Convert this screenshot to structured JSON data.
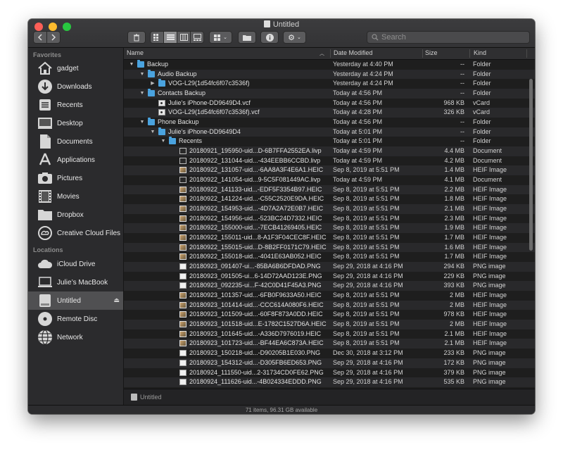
{
  "window": {
    "title": "Untitled"
  },
  "toolbar": {
    "back_icon": "chevron-left-icon",
    "forward_icon": "chevron-right-icon",
    "trash_icon": "trash-icon",
    "view_modes": [
      "icon-view",
      "list-view",
      "column-view",
      "gallery-view"
    ],
    "active_view": "list-view",
    "group_icon": "group-by-icon",
    "newfolder_icon": "new-folder-icon",
    "info_icon": "info-icon",
    "action_icon": "gear-icon",
    "search_placeholder": "Search"
  },
  "sidebar": {
    "favorites_header": "Favorites",
    "favorites": [
      {
        "label": "gadget",
        "icon": "home-icon"
      },
      {
        "label": "Downloads",
        "icon": "download-icon"
      },
      {
        "label": "Recents",
        "icon": "recents-icon"
      },
      {
        "label": "Desktop",
        "icon": "desktop-icon"
      },
      {
        "label": "Documents",
        "icon": "documents-icon"
      },
      {
        "label": "Applications",
        "icon": "applications-icon"
      },
      {
        "label": "Pictures",
        "icon": "pictures-icon"
      },
      {
        "label": "Movies",
        "icon": "movies-icon"
      },
      {
        "label": "Dropbox",
        "icon": "folder-icon"
      },
      {
        "label": "Creative Cloud Files",
        "icon": "creative-cloud-icon"
      }
    ],
    "locations_header": "Locations",
    "locations": [
      {
        "label": "iCloud Drive",
        "icon": "cloud-icon"
      },
      {
        "label": "Julie’s MacBook",
        "icon": "laptop-icon"
      },
      {
        "label": "Untitled",
        "icon": "drive-icon",
        "selected": true
      },
      {
        "label": "Remote Disc",
        "icon": "disc-icon"
      },
      {
        "label": "Network",
        "icon": "network-icon"
      }
    ],
    "eject_icon": "eject-icon"
  },
  "columns": {
    "name": "Name",
    "date": "Date Modified",
    "size": "Size",
    "kind": "Kind"
  },
  "files": [
    {
      "name": "Backup",
      "date": "Yesterday at 4:40 PM",
      "size": "--",
      "kind": "Folder",
      "level": 0,
      "disclosure": "open",
      "icon": "folder"
    },
    {
      "name": "Audio Backup",
      "date": "Yesterday at 4:24 PM",
      "size": "--",
      "kind": "Folder",
      "level": 1,
      "disclosure": "open",
      "icon": "folder"
    },
    {
      "name": "VOG-L29(1d54fc6f07c3536f)",
      "date": "Yesterday at 4:24 PM",
      "size": "--",
      "kind": "Folder",
      "level": 2,
      "disclosure": "closed",
      "icon": "folder"
    },
    {
      "name": "Contacts Backup",
      "date": "Today at 4:56 PM",
      "size": "--",
      "kind": "Folder",
      "level": 1,
      "disclosure": "open",
      "icon": "folder"
    },
    {
      "name": "Julie’s iPhone-DD9649D4.vcf",
      "date": "Today at 4:56 PM",
      "size": "968 KB",
      "kind": "vCard",
      "level": 2,
      "disclosure": "none",
      "icon": "vcard"
    },
    {
      "name": "VOG-L29(1d54fc6f07c3536f).vcf",
      "date": "Today at 4:28 PM",
      "size": "326 KB",
      "kind": "vCard",
      "level": 2,
      "disclosure": "none",
      "icon": "vcard"
    },
    {
      "name": "Phone Backup",
      "date": "Today at 4:56 PM",
      "size": "--",
      "kind": "Folder",
      "level": 1,
      "disclosure": "open",
      "icon": "folder"
    },
    {
      "name": "Julie’s iPhone-DD9649D4",
      "date": "Today at 5:01 PM",
      "size": "--",
      "kind": "Folder",
      "level": 2,
      "disclosure": "open",
      "icon": "folder"
    },
    {
      "name": "Recents",
      "date": "Today at 5:01 PM",
      "size": "--",
      "kind": "Folder",
      "level": 3,
      "disclosure": "open",
      "icon": "folder"
    },
    {
      "name": "20180921_195950-uid...D-6B7FFA2552EA.livp",
      "date": "Today at 4:59 PM",
      "size": "4.4 MB",
      "kind": "Document",
      "level": 4,
      "disclosure": "none",
      "icon": "doc"
    },
    {
      "name": "20180922_131044-uid...-434EEBB6CCBD.livp",
      "date": "Today at 4:59 PM",
      "size": "4.2 MB",
      "kind": "Document",
      "level": 4,
      "disclosure": "none",
      "icon": "doc"
    },
    {
      "name": "20180922_131057-uid...-6AA8A3F4E6A1.HEIC",
      "date": "Sep 8, 2019 at 5:51 PM",
      "size": "1.4 MB",
      "kind": "HEIF Image",
      "level": 4,
      "disclosure": "none",
      "icon": "img"
    },
    {
      "name": "20180922_141054-uid...9-5C5F081449AC.livp",
      "date": "Today at 4:59 PM",
      "size": "4.1 MB",
      "kind": "Document",
      "level": 4,
      "disclosure": "none",
      "icon": "doc"
    },
    {
      "name": "20180922_141133-uid...-EDF5F3354B97.HEIC",
      "date": "Sep 8, 2019 at 5:51 PM",
      "size": "2.2 MB",
      "kind": "HEIF Image",
      "level": 4,
      "disclosure": "none",
      "icon": "img"
    },
    {
      "name": "20180922_141224-uid...-C55C2520E9DA.HEIC",
      "date": "Sep 8, 2019 at 5:51 PM",
      "size": "1.8 MB",
      "kind": "HEIF Image",
      "level": 4,
      "disclosure": "none",
      "icon": "img"
    },
    {
      "name": "20180922_154953-uid...-4D7A2A72E0B7.HEIC",
      "date": "Sep 8, 2019 at 5:51 PM",
      "size": "2.1 MB",
      "kind": "HEIF Image",
      "level": 4,
      "disclosure": "none",
      "icon": "img"
    },
    {
      "name": "20180922_154956-uid...-523BC24D7332.HEIC",
      "date": "Sep 8, 2019 at 5:51 PM",
      "size": "2.3 MB",
      "kind": "HEIF Image",
      "level": 4,
      "disclosure": "none",
      "icon": "img"
    },
    {
      "name": "20180922_155000-uid...-7ECB41269405.HEIC",
      "date": "Sep 8, 2019 at 5:51 PM",
      "size": "1.9 MB",
      "kind": "HEIF Image",
      "level": 4,
      "disclosure": "none",
      "icon": "img"
    },
    {
      "name": "20180922_155011-uid...8-A1F3F04CEC8F.HEIC",
      "date": "Sep 8, 2019 at 5:51 PM",
      "size": "1.7 MB",
      "kind": "HEIF Image",
      "level": 4,
      "disclosure": "none",
      "icon": "img"
    },
    {
      "name": "20180922_155015-uid...D-8B2FF0171C79.HEIC",
      "date": "Sep 8, 2019 at 5:51 PM",
      "size": "1.6 MB",
      "kind": "HEIF Image",
      "level": 4,
      "disclosure": "none",
      "icon": "img"
    },
    {
      "name": "20180922_155018-uid...-4041E63AB052.HEIC",
      "date": "Sep 8, 2019 at 5:51 PM",
      "size": "1.7 MB",
      "kind": "HEIF Image",
      "level": 4,
      "disclosure": "none",
      "icon": "img"
    },
    {
      "name": "20180923_091407-ui...-85BA6B6DFDAD.PNG",
      "date": "Sep 29, 2018 at 4:16 PM",
      "size": "294 KB",
      "kind": "PNG image",
      "level": 4,
      "disclosure": "none",
      "icon": "png"
    },
    {
      "name": "20180923_091505-ui...6-14D72AAD123E.PNG",
      "date": "Sep 29, 2018 at 4:16 PM",
      "size": "229 KB",
      "kind": "PNG image",
      "level": 4,
      "disclosure": "none",
      "icon": "png"
    },
    {
      "name": "20180923_092235-ui...F-42C0D41F45A3.PNG",
      "date": "Sep 29, 2018 at 4:16 PM",
      "size": "393 KB",
      "kind": "PNG image",
      "level": 4,
      "disclosure": "none",
      "icon": "png"
    },
    {
      "name": "20180923_101357-uid...-6FB0F9633A50.HEIC",
      "date": "Sep 8, 2019 at 5:51 PM",
      "size": "2 MB",
      "kind": "HEIF Image",
      "level": 4,
      "disclosure": "none",
      "icon": "img"
    },
    {
      "name": "20180923_101414-uid...-CCC614A080F6.HEIC",
      "date": "Sep 8, 2019 at 5:51 PM",
      "size": "2 MB",
      "kind": "HEIF Image",
      "level": 4,
      "disclosure": "none",
      "icon": "img"
    },
    {
      "name": "20180923_101509-uid...-60F8F873A0DD.HEIC",
      "date": "Sep 8, 2019 at 5:51 PM",
      "size": "978 KB",
      "kind": "HEIF Image",
      "level": 4,
      "disclosure": "none",
      "icon": "img"
    },
    {
      "name": "20180923_101518-uid...E-1782C1527D6A.HEIC",
      "date": "Sep 8, 2019 at 5:51 PM",
      "size": "2 MB",
      "kind": "HEIF Image",
      "level": 4,
      "disclosure": "none",
      "icon": "img"
    },
    {
      "name": "20180923_101645-uid...-A336D7976019.HEIC",
      "date": "Sep 8, 2019 at 5:51 PM",
      "size": "2.1 MB",
      "kind": "HEIF Image",
      "level": 4,
      "disclosure": "none",
      "icon": "img"
    },
    {
      "name": "20180923_101723-uid...-BF44EA6C873A.HEIC",
      "date": "Sep 8, 2019 at 5:51 PM",
      "size": "2.1 MB",
      "kind": "HEIF Image",
      "level": 4,
      "disclosure": "none",
      "icon": "img"
    },
    {
      "name": "20180923_150218-uid...-D90205B1E030.PNG",
      "date": "Dec 30, 2018 at 3:12 PM",
      "size": "233 KB",
      "kind": "PNG image",
      "level": 4,
      "disclosure": "none",
      "icon": "png"
    },
    {
      "name": "20180923_154312-uid...-D305FB6ED653.PNG",
      "date": "Sep 29, 2018 at 4:16 PM",
      "size": "172 KB",
      "kind": "PNG image",
      "level": 4,
      "disclosure": "none",
      "icon": "png"
    },
    {
      "name": "20180924_111550-uid...2-31734CD0FE62.PNG",
      "date": "Sep 29, 2018 at 4:16 PM",
      "size": "379 KB",
      "kind": "PNG image",
      "level": 4,
      "disclosure": "none",
      "icon": "png"
    },
    {
      "name": "20180924_111626-uid...-4B024334EDDD.PNG",
      "date": "Sep 29, 2018 at 4:16 PM",
      "size": "535 KB",
      "kind": "PNG image",
      "level": 4,
      "disclosure": "none",
      "icon": "png"
    }
  ],
  "pathbar": {
    "label": "Untitled",
    "icon": "drive-icon"
  },
  "status": {
    "text": "71 items, 96.31 GB available"
  }
}
